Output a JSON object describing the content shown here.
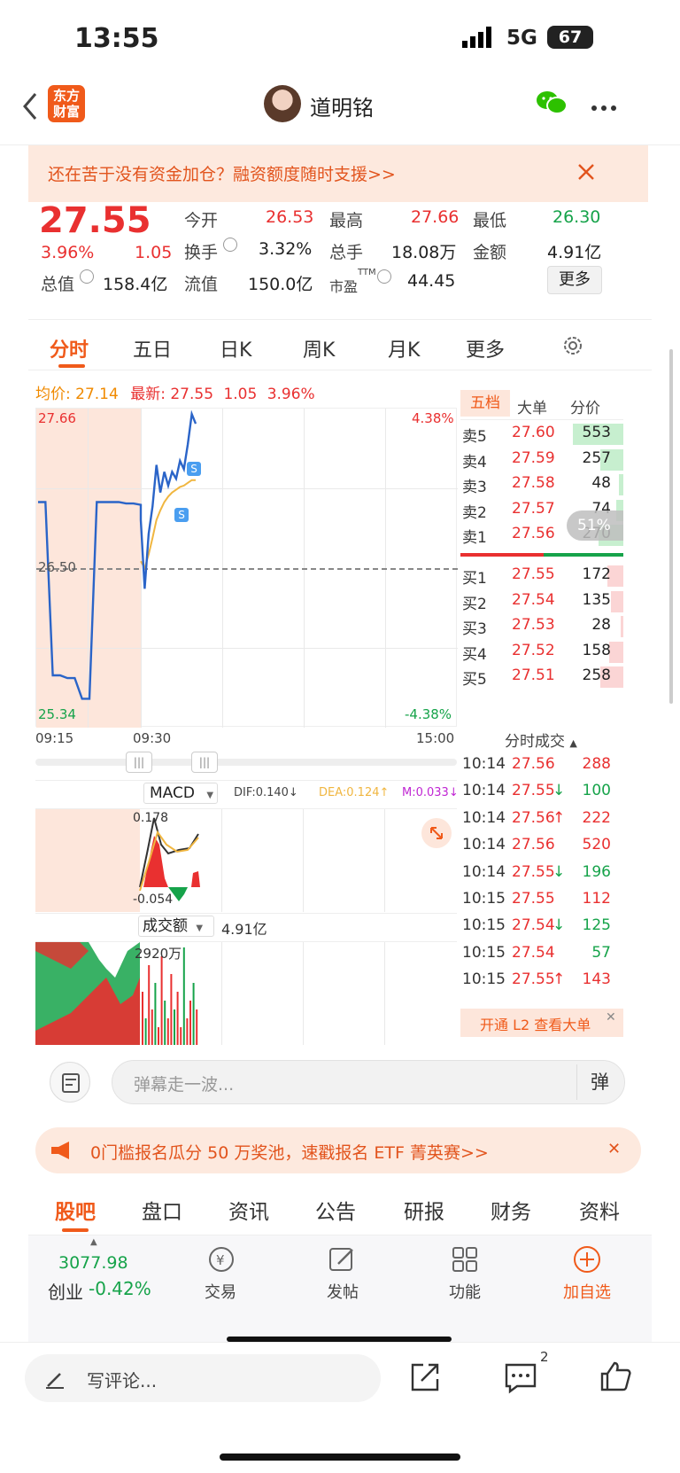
{
  "status": {
    "time": "13:55",
    "network": "5G",
    "battery": "67"
  },
  "nav": {
    "logo_line1": "东方",
    "logo_line2": "财富",
    "username": "道明铭"
  },
  "banner": {
    "text": "还在苦于没有资金加仓？融资额度随时支援>>"
  },
  "quote": {
    "price": "27.55",
    "change_pct": "3.96%",
    "change": "1.05",
    "open_label": "今开",
    "open": "26.53",
    "high_label": "最高",
    "high": "27.66",
    "low_label": "最低",
    "low": "26.30",
    "turnover_label": "换手",
    "turnover": "3.32%",
    "volume_label": "总手",
    "volume": "18.08万",
    "amount_label": "金额",
    "amount": "4.91亿",
    "mktcap_label": "总值",
    "mktcap": "158.4亿",
    "float_label": "流值",
    "float": "150.0亿",
    "pe_label": "市盈",
    "pe_sup": "TTM",
    "pe": "44.45",
    "more": "更多"
  },
  "period_tabs": [
    "分时",
    "五日",
    "日K",
    "周K",
    "月K",
    "更多"
  ],
  "chart_header": {
    "avg_label": "均价:",
    "avg": "27.14",
    "last_label": "最新:",
    "last": "27.55",
    "chg": "1.05",
    "pct": "3.96%"
  },
  "chart_labels": {
    "y_top": "27.66",
    "y_mid": "26.50",
    "y_bottom": "25.34",
    "pct_top": "4.38%",
    "pct_bottom": "-4.38%",
    "t_start": "09:15",
    "t_open": "09:30",
    "t_end": "15:00",
    "s_marker": "S"
  },
  "chart_data": {
    "type": "line",
    "title": "",
    "ylim": [
      25.34,
      27.66
    ],
    "series": [
      {
        "name": "",
        "values": [
          26.98,
          26.98,
          25.72,
          25.72,
          25.7,
          25.7,
          25.55,
          25.55,
          26.98,
          26.98,
          26.98,
          26.98,
          26.97,
          26.97,
          26.96,
          26.85,
          26.35,
          26.75,
          26.95,
          27.25,
          27.05,
          27.2,
          27.1,
          27.2,
          27.15,
          27.28,
          27.22,
          27.4,
          27.62,
          27.55
        ]
      },
      {
        "name": "",
        "values": [
          26.5,
          26.5,
          26.5,
          26.5,
          26.5,
          26.5,
          26.5,
          26.5,
          26.5,
          26.5,
          26.5,
          26.5,
          26.5,
          26.5,
          26.5,
          26.55,
          26.5,
          26.6,
          26.72,
          26.85,
          26.92,
          26.98,
          27.02,
          27.05,
          27.07,
          27.09,
          27.1,
          27.12,
          27.14,
          27.14
        ]
      }
    ],
    "macd": {
      "dif": "0.140",
      "dea": "0.124",
      "m": "0.033",
      "max_label": "0.178",
      "min_label": "-0.054"
    },
    "volume": {
      "total": "4.91亿",
      "max_label": "2920万"
    }
  },
  "orderbook": {
    "tabs": [
      "五档",
      "大单",
      "分价"
    ],
    "sells": [
      {
        "label": "卖5",
        "price": "27.60",
        "vol": "553",
        "ratio": 0.95
      },
      {
        "label": "卖4",
        "price": "27.59",
        "vol": "257",
        "ratio": 0.44
      },
      {
        "label": "卖3",
        "price": "27.58",
        "vol": "48",
        "ratio": 0.08
      },
      {
        "label": "卖2",
        "price": "27.57",
        "vol": "74",
        "ratio": 0.13
      },
      {
        "label": "卖1",
        "price": "27.56",
        "vol": "270",
        "ratio": 0.46
      }
    ],
    "buys": [
      {
        "label": "买1",
        "price": "27.55",
        "vol": "172",
        "ratio": 0.3
      },
      {
        "label": "买2",
        "price": "27.54",
        "vol": "135",
        "ratio": 0.23
      },
      {
        "label": "买3",
        "price": "27.53",
        "vol": "28",
        "ratio": 0.05
      },
      {
        "label": "买4",
        "price": "27.52",
        "vol": "158",
        "ratio": 0.27
      },
      {
        "label": "买5",
        "price": "27.51",
        "vol": "258",
        "ratio": 0.44
      }
    ],
    "ratio_badge": "51%"
  },
  "trades": {
    "title": "分时成交",
    "rows": [
      {
        "time": "10:14",
        "price": "27.56",
        "dir": "",
        "vol": "288",
        "c": "red"
      },
      {
        "time": "10:14",
        "price": "27.55",
        "dir": "↓",
        "vol": "100",
        "c": "green"
      },
      {
        "time": "10:14",
        "price": "27.56",
        "dir": "↑",
        "vol": "222",
        "c": "red"
      },
      {
        "time": "10:14",
        "price": "27.56",
        "dir": "",
        "vol": "520",
        "c": "red"
      },
      {
        "time": "10:14",
        "price": "27.55",
        "dir": "↓",
        "vol": "196",
        "c": "green"
      },
      {
        "time": "10:15",
        "price": "27.55",
        "dir": "",
        "vol": "112",
        "c": "red"
      },
      {
        "time": "10:15",
        "price": "27.54",
        "dir": "↓",
        "vol": "125",
        "c": "green"
      },
      {
        "time": "10:15",
        "price": "27.54",
        "dir": "",
        "vol": "57",
        "c": "green"
      },
      {
        "time": "10:15",
        "price": "27.55",
        "dir": "↑",
        "vol": "143",
        "c": "red"
      }
    ],
    "l2": "开通 L2 查看大单"
  },
  "indicators": {
    "macd_label": "MACD",
    "vol_label": "成交额"
  },
  "danmaku": {
    "placeholder": "弹幕走一波...",
    "btn": "弹"
  },
  "promo": {
    "text": "0门槛报名瓜分 50 万奖池，速戳报名 ETF 菁英赛>>"
  },
  "bottom_tabs": [
    "股吧",
    "盘口",
    "资讯",
    "公告",
    "研报",
    "财务",
    "资料"
  ],
  "index_bar": {
    "value": "3077.98",
    "name": "创业",
    "pct": "-0.42%",
    "trade": "交易",
    "post": "发帖",
    "func": "功能",
    "add": "加自选"
  },
  "comment": {
    "placeholder": "写评论...",
    "msg_count": "2"
  }
}
